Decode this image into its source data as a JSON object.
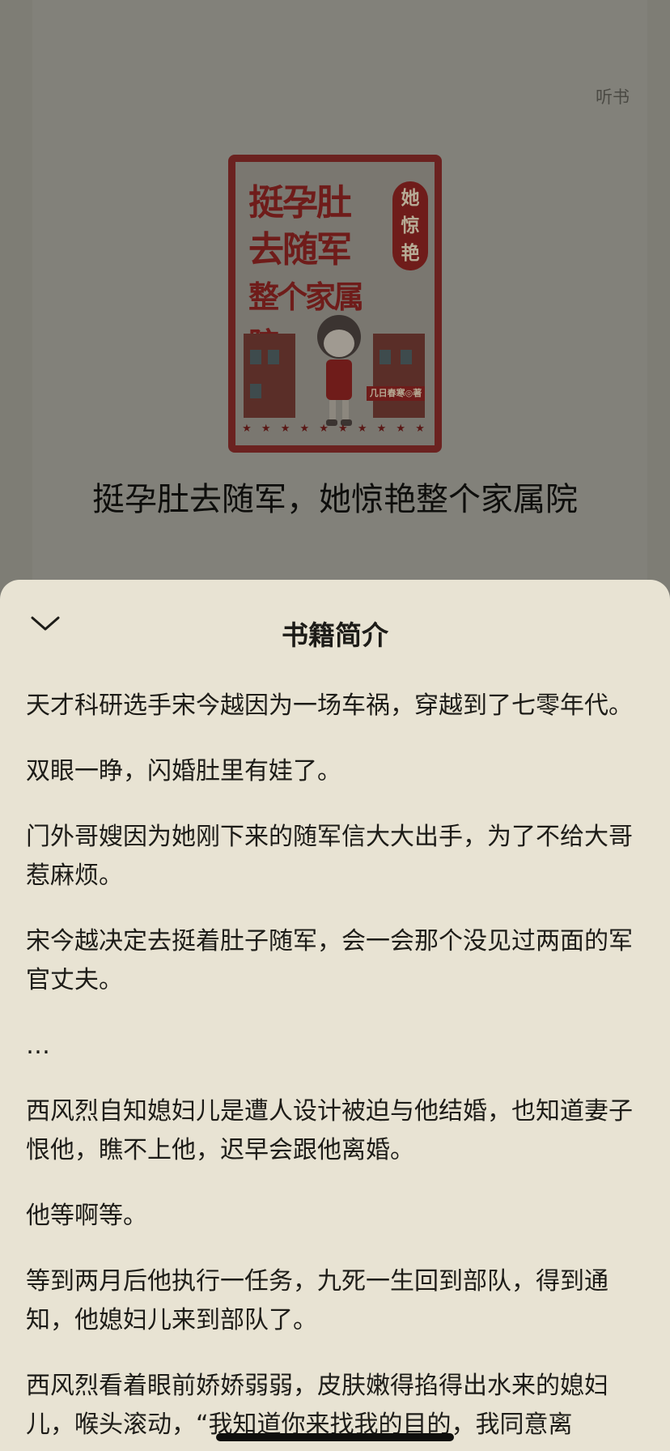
{
  "header": {
    "listen_label": "听书"
  },
  "cover": {
    "title_lines": [
      "挺孕肚",
      "去随军",
      "整个家属院"
    ],
    "seal_chars": [
      "她",
      "惊",
      "艳"
    ],
    "author_tag": "几日春寒◎著",
    "stars": "★ ★ ★ ★ ★ ★ ★ ★ ★ ★"
  },
  "book": {
    "title": "挺孕肚去随军，她惊艳整个家属院"
  },
  "sheet": {
    "collapse_icon": "chevron-down-icon",
    "title": "书籍简介",
    "paragraphs": [
      "天才科研选手宋今越因为一场车祸，穿越到了七零年代。",
      "双眼一睁，闪婚肚里有娃了。",
      "门外哥嫂因为她刚下来的随军信大大出手，为了不给大哥惹麻烦。",
      "宋今越决定去挺着肚子随军，会一会那个没见过两面的军官丈夫。",
      "…",
      "西风烈自知媳妇儿是遭人设计被迫与他结婚，也知道妻子恨他，瞧不上他，迟早会跟他离婚。",
      "他等啊等。",
      "等到两月后他执行一任务，九死一生回到部队，得到通知，他媳妇儿来到部队了。",
      "西风烈看着眼前娇娇弱弱，皮肤嫩得掐得出水来的媳妇儿，喉头滚动，“我知道你来找我的目的，我同意离"
    ]
  },
  "colors": {
    "sheet_bg": "#e8e3d3",
    "backdrop": "#7e7d75",
    "cover_red": "#6f1c1a"
  }
}
